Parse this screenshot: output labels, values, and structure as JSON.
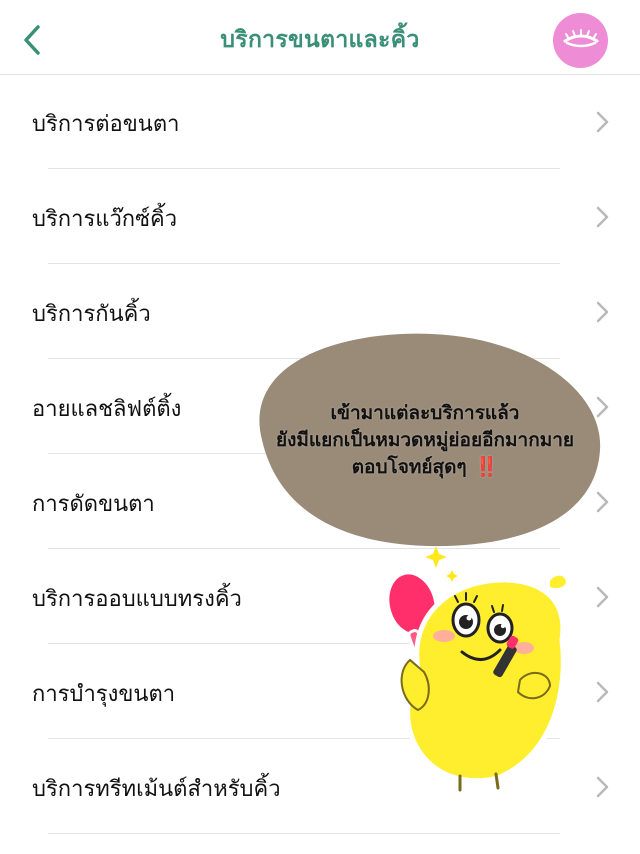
{
  "header": {
    "title": "บริการขนตาและคิ้ว",
    "back_icon": "chevron-left-icon",
    "avatar_icon": "eyelash-icon",
    "accent_color": "#3a8f77",
    "avatar_color": "#ee8cd6"
  },
  "services": [
    {
      "label": "บริการต่อขนตา"
    },
    {
      "label": "บริการแว๊กซ์คิ้ว"
    },
    {
      "label": "บริการกันคิ้ว"
    },
    {
      "label": "อายแลชลิฟต์ติ้ง"
    },
    {
      "label": "การดัดขนตา"
    },
    {
      "label": "บริการออบแบบทรงคิ้ว"
    },
    {
      "label": "การบำรุงขนตา"
    },
    {
      "label": "บริการทรีทเม้นต์สำหรับคิ้ว"
    }
  ],
  "overlay": {
    "line1": "เข้ามาแต่ละบริการแล้ว",
    "line2": "ยังมีแยกเป็นหมวดหมู่ย่อยอีกมากมาย",
    "line3": "ตอบโจทย์สุดๆ",
    "exclaim": "‼️",
    "bubble_color": "#9a8b79",
    "sticker": "lemon-mascot-with-mirror"
  }
}
